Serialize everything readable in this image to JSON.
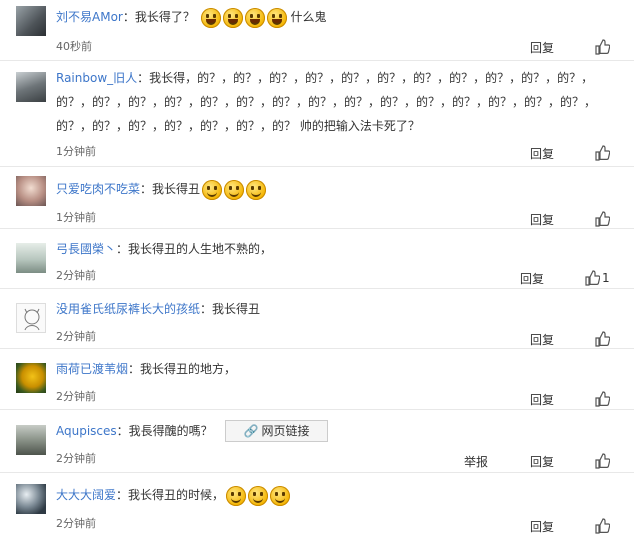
{
  "actions": {
    "reply": "回复",
    "report": "举报"
  },
  "comments": [
    {
      "user": "刘不易AMor",
      "sep": "：",
      "text": "我长得了？",
      "after_emoji": "什么鬼",
      "time": "40秒前"
    },
    {
      "user": "Rainbow_旧人",
      "sep": "：",
      "text": "我长得，的？，的？，的？，的？，的？，的？，的？，的？，的？，的？，的？，的？，的？，的？，的？，的？，的？，的？，的？，的？，的？，的？，的？，的？，的？，的？，的？，的？，的？，的？，的？，的？，的？ 帅的把输入法卡死了？",
      "time": "1分钟前"
    },
    {
      "user": "只爱吃肉不吃菜",
      "sep": "：",
      "text": "我长得丑",
      "time": "1分钟前"
    },
    {
      "user": "弓長國榮丶",
      "sep": "：",
      "text": "我长得丑的人生地不熟的，",
      "time": "2分钟前",
      "likes": "1"
    },
    {
      "user": "没用雀氏纸尿裤长大的孩纸",
      "sep": "：",
      "text": "我长得丑",
      "time": "2分钟前"
    },
    {
      "user": "雨荷已渡苇烟",
      "sep": "：",
      "text": "我长得丑的地方，",
      "time": "2分钟前"
    },
    {
      "user": "Aqupisces",
      "sep": "：",
      "text": "我長得醜的嗎？",
      "link": "网页链接",
      "time": "2分钟前"
    },
    {
      "user": "大大大阔爱",
      "sep": "：",
      "text": "我长得丑的时候，",
      "time": "2分钟前"
    }
  ],
  "colors": {
    "username": "#3d76c9",
    "text": "#333333",
    "divider": "#e8e8e8"
  }
}
